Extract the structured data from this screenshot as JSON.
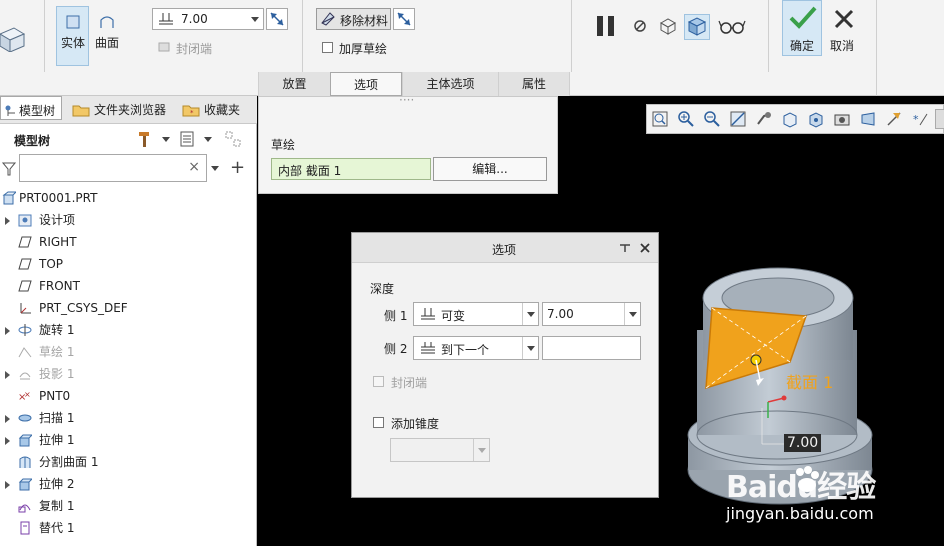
{
  "ribbon": {
    "solid_label": "实体",
    "surface_label": "曲面",
    "cap_ends_label": "封闭端",
    "depth_value": "7.00",
    "remove_material_label": "移除材料",
    "thicken_sketch_label": "加厚草绘",
    "ok_label": "确定",
    "cancel_label": "取消",
    "tabs": [
      "放置",
      "选项",
      "主体选项",
      "属性"
    ]
  },
  "left_panel": {
    "tabs": [
      "模型树",
      "文件夹浏览器",
      "收藏夹"
    ],
    "header_label": "模型树",
    "search_placeholder": "",
    "tree": [
      {
        "label": "PRT0001.PRT",
        "expand": false,
        "dim": false,
        "icon": "part-icon"
      },
      {
        "label": "设计项",
        "expand": true,
        "dim": false,
        "icon": "design-items-icon"
      },
      {
        "label": "RIGHT",
        "expand": false,
        "dim": false,
        "icon": "datum-plane-icon"
      },
      {
        "label": "TOP",
        "expand": false,
        "dim": false,
        "icon": "datum-plane-icon"
      },
      {
        "label": "FRONT",
        "expand": false,
        "dim": false,
        "icon": "datum-plane-icon"
      },
      {
        "label": "PRT_CSYS_DEF",
        "expand": false,
        "dim": false,
        "icon": "csys-icon"
      },
      {
        "label": "旋转 1",
        "expand": true,
        "dim": false,
        "icon": "revolve-icon"
      },
      {
        "label": "草绘 1",
        "expand": false,
        "dim": true,
        "icon": "sketch-icon"
      },
      {
        "label": "投影 1",
        "expand": true,
        "dim": true,
        "icon": "projection-icon"
      },
      {
        "label": "PNT0",
        "expand": false,
        "dim": false,
        "icon": "datum-point-icon"
      },
      {
        "label": "扫描 1",
        "expand": true,
        "dim": false,
        "icon": "sweep-icon"
      },
      {
        "label": "拉伸 1",
        "expand": true,
        "dim": false,
        "icon": "extrude-icon"
      },
      {
        "label": "分割曲面 1",
        "expand": false,
        "dim": false,
        "icon": "split-surface-icon"
      },
      {
        "label": "拉伸 2",
        "expand": true,
        "dim": false,
        "icon": "extrude-icon"
      },
      {
        "label": "复制 1",
        "expand": false,
        "dim": false,
        "icon": "copy-icon"
      },
      {
        "label": "替代 1",
        "expand": false,
        "dim": false,
        "icon": "replace-icon"
      }
    ]
  },
  "dash_panel": {
    "title": "草绘",
    "section_value": "内部 截面 1",
    "edit_button": "编辑..."
  },
  "options_dialog": {
    "title": "选项",
    "depth_label": "深度",
    "side1_label": "侧 1",
    "side1_type": "可变",
    "side1_value": "7.00",
    "side2_label": "侧 2",
    "side2_type": "到下一个",
    "side2_value": "",
    "cap_ends_label": "封闭端",
    "add_taper_label": "添加锥度",
    "taper_value": ""
  },
  "viewport": {
    "section_label": "截面 1",
    "dimension_label": "7.00",
    "watermark_brand": "Baidu经验",
    "watermark_url": "jingyan.baidu.com"
  },
  "colors": {
    "accent_blue": "#d6e8f5",
    "section_orange": "#f0a21c",
    "model_gray": "#a9b3bd",
    "ok_green": "#3aa04a"
  }
}
